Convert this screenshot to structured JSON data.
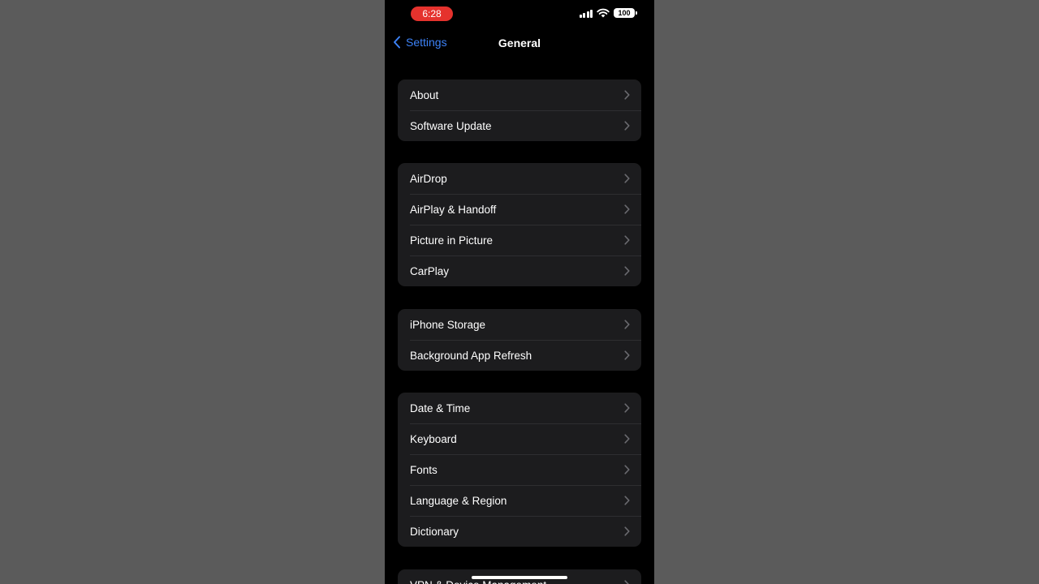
{
  "status_bar": {
    "time": "6:28",
    "battery": "100"
  },
  "nav": {
    "back_label": "Settings",
    "title": "General"
  },
  "groups": [
    {
      "items": [
        "About",
        "Software Update"
      ]
    },
    {
      "items": [
        "AirDrop",
        "AirPlay & Handoff",
        "Picture in Picture",
        "CarPlay"
      ]
    },
    {
      "items": [
        "iPhone Storage",
        "Background App Refresh"
      ]
    },
    {
      "items": [
        "Date & Time",
        "Keyboard",
        "Fonts",
        "Language & Region",
        "Dictionary"
      ]
    },
    {
      "items": [
        "VPN & Device Management"
      ]
    }
  ],
  "colors": {
    "accent": "#3d82f6",
    "time_pill": "#e5322d",
    "cell": "#1c1c1e"
  }
}
